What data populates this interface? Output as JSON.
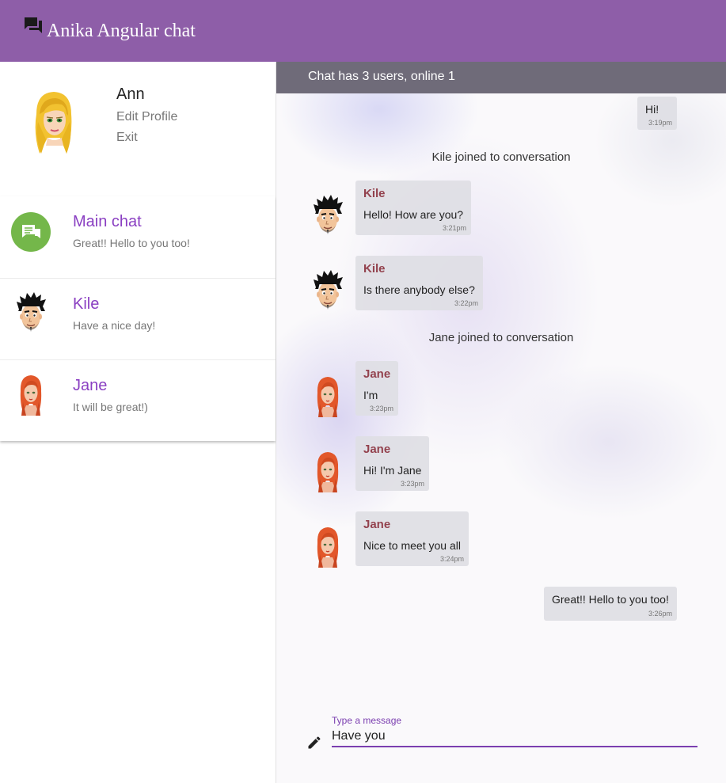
{
  "app": {
    "title": "Anika Angular chat",
    "icon": "forum-icon"
  },
  "profile": {
    "name": "Ann",
    "edit_label": "Edit Profile",
    "exit_label": "Exit"
  },
  "chats": [
    {
      "title": "Main chat",
      "preview": "Great!! Hello to you too!",
      "icon": "chat-bubbles-icon"
    },
    {
      "title": "Kile",
      "preview": "Have a nice day!"
    },
    {
      "title": "Jane",
      "preview": "It will be great!)"
    }
  ],
  "conversation": {
    "status": "Chat has 3 users, online 1",
    "messages": [
      {
        "text": "Hi!",
        "time": "3:19pm",
        "own": true
      },
      {
        "system": "Kile joined to conversation"
      },
      {
        "sender": "Kile",
        "text": "Hello! How are you?",
        "time": "3:21pm"
      },
      {
        "sender": "Kile",
        "text": "Is there anybody else?",
        "time": "3:22pm"
      },
      {
        "system": "Jane joined to conversation"
      },
      {
        "sender": "Jane",
        "text": "I'm",
        "time": "3:23pm"
      },
      {
        "sender": "Jane",
        "text": "Hi! I'm Jane",
        "time": "3:23pm"
      },
      {
        "sender": "Jane",
        "text": "Nice to meet you all",
        "time": "3:24pm"
      },
      {
        "text": "Great!! Hello to you too!",
        "time": "3:26pm",
        "own": true
      }
    ]
  },
  "composer": {
    "label": "Type a message",
    "value": "Have you",
    "icon": "pencil-icon"
  },
  "colors": {
    "header": "#8e5ea8",
    "accent": "#7b3fb0",
    "chat_title": "#8a3fc2",
    "sender": "#93424e",
    "status_bar": "#6f6b79",
    "chat_icon_bg": "#74b74a"
  }
}
